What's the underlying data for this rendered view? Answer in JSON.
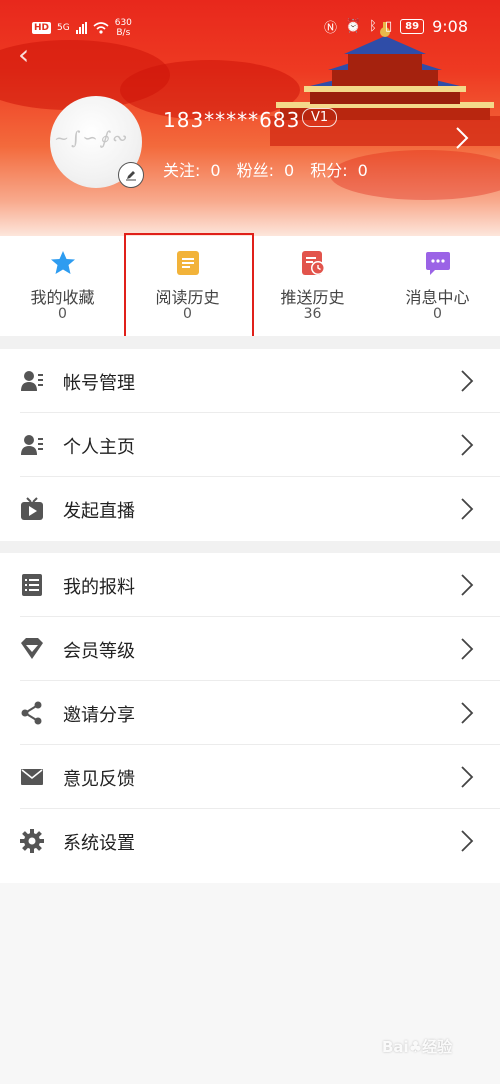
{
  "status_bar": {
    "hd": "HD",
    "signal": "5G",
    "net_speed_value": "630",
    "net_speed_unit": "B/s",
    "battery": "89",
    "time": "9:08"
  },
  "profile": {
    "username": "183*****683",
    "level": "V1",
    "follow_label": "关注:",
    "follow_value": "0",
    "fans_label": "粉丝:",
    "fans_value": "0",
    "points_label": "积分:",
    "points_value": "0"
  },
  "quick_links": [
    {
      "label": "我的收藏",
      "count": "0",
      "icon": "star-icon",
      "color": "#2e9cf0"
    },
    {
      "label": "阅读历史",
      "count": "0",
      "icon": "document-icon",
      "color": "#f2b33a"
    },
    {
      "label": "推送历史",
      "count": "36",
      "icon": "clock-doc-icon",
      "color": "#e2544c"
    },
    {
      "label": "消息中心",
      "count": "0",
      "icon": "message-icon",
      "color": "#9b63e6"
    }
  ],
  "menu_group_1": [
    {
      "label": "帐号管理",
      "icon": "account-icon"
    },
    {
      "label": "个人主页",
      "icon": "profile-icon"
    },
    {
      "label": "发起直播",
      "icon": "live-tv-icon"
    }
  ],
  "menu_group_2": [
    {
      "label": "我的报料",
      "icon": "list-icon"
    },
    {
      "label": "会员等级",
      "icon": "diamond-icon"
    },
    {
      "label": "邀请分享",
      "icon": "share-icon"
    },
    {
      "label": "意见反馈",
      "icon": "mail-icon"
    },
    {
      "label": "系统设置",
      "icon": "gear-icon"
    }
  ],
  "colors": {
    "header_red": "#e8281c",
    "highlight_box": "#e0201a"
  }
}
